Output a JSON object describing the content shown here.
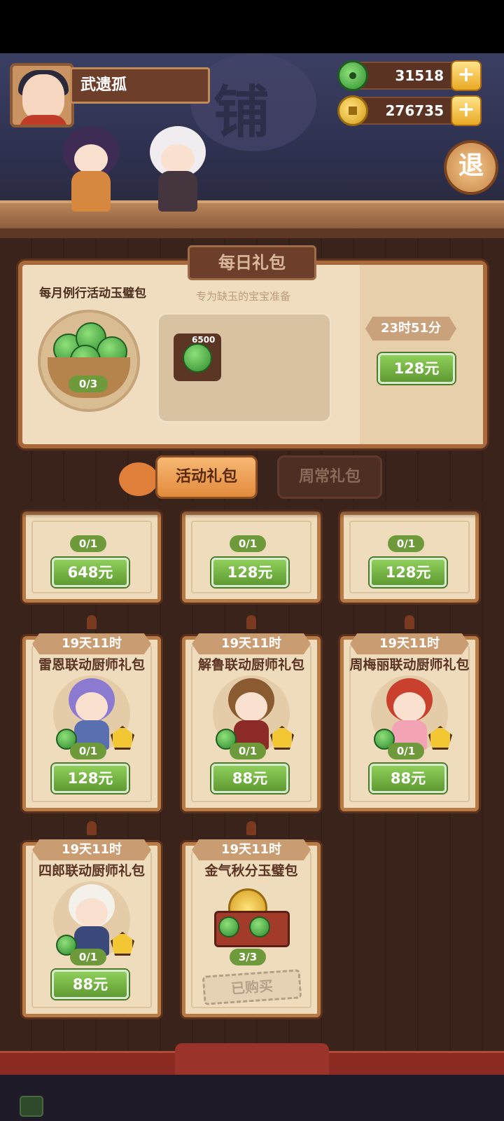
{
  "header": {
    "player_name": "武遗孤",
    "shop_sign_char": "铺",
    "currencies": [
      {
        "icon": "jade-icon",
        "value": "31518"
      },
      {
        "icon": "coin-icon",
        "value": "276735"
      }
    ],
    "plus_label": "+",
    "exit_label": "退"
  },
  "daily": {
    "title": "每日礼包",
    "pack_name": "每月例行活动玉璧包",
    "subtitle": "专为缺玉的宝宝准备",
    "progress": "0/3",
    "reward_qty": "6500",
    "timer": "23时51分",
    "price": "128元"
  },
  "tabs": [
    {
      "label": "活动礼包",
      "active": true
    },
    {
      "label": "周常礼包",
      "active": false
    }
  ],
  "top_row": [
    {
      "progress": "0/1",
      "price": "648元"
    },
    {
      "progress": "0/1",
      "price": "128元"
    },
    {
      "progress": "0/1",
      "price": "128元"
    }
  ],
  "packs": [
    {
      "timer": "19天11时",
      "title": "雷恩联动厨师礼包",
      "progress": "0/1",
      "price": "128元"
    },
    {
      "timer": "19天11时",
      "title": "解鲁联动厨师礼包",
      "progress": "0/1",
      "price": "88元"
    },
    {
      "timer": "19天11时",
      "title": "周梅丽联动厨师礼包",
      "progress": "0/1",
      "price": "88元"
    },
    {
      "timer": "19天11时",
      "title": "四郎联动厨师礼包",
      "progress": "0/1",
      "price": "88元"
    },
    {
      "timer": "19天11时",
      "title": "金气秋分玉璧包",
      "progress": "3/3",
      "status": "已购买"
    }
  ]
}
